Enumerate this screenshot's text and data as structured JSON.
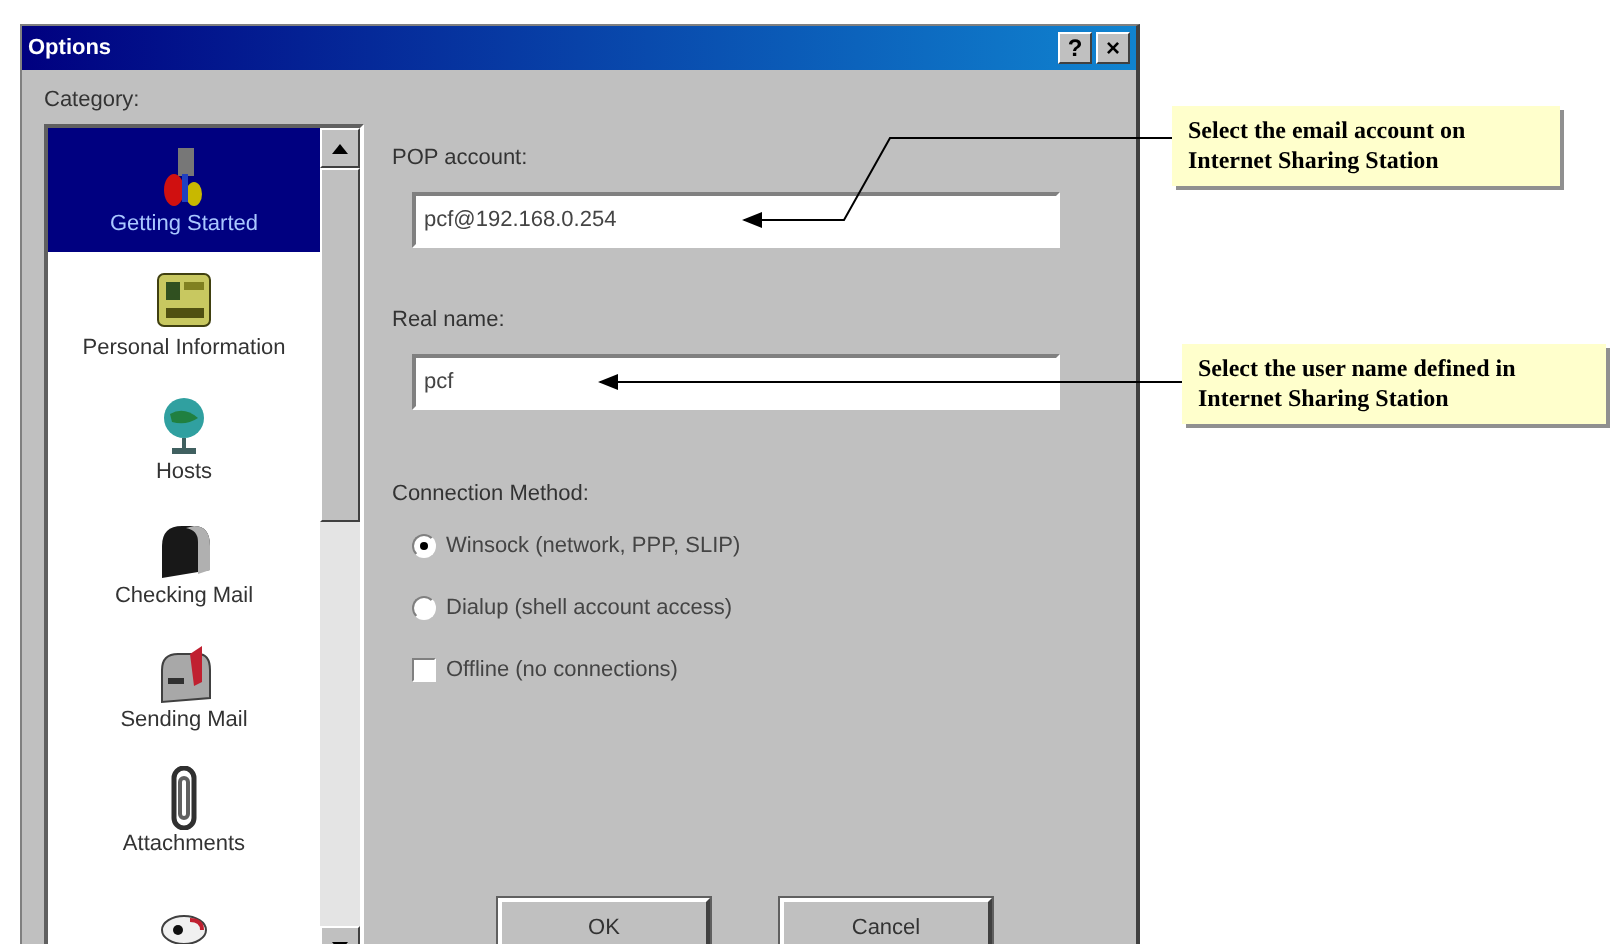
{
  "window": {
    "title": "Options",
    "help_button": "?",
    "close_button": "×"
  },
  "category": {
    "label": "Category:",
    "items": [
      {
        "label": "Getting Started",
        "selected": true
      },
      {
        "label": "Personal Information",
        "selected": false
      },
      {
        "label": "Hosts",
        "selected": false
      },
      {
        "label": "Checking Mail",
        "selected": false
      },
      {
        "label": "Sending Mail",
        "selected": false
      },
      {
        "label": "Attachments",
        "selected": false
      },
      {
        "selected": false
      }
    ]
  },
  "fields": [
    {
      "label": "POP account:",
      "value": "pcf@192.168.0.254"
    },
    {
      "label": "Real name:",
      "value": "pcf"
    }
  ],
  "connection": {
    "label": "Connection Method:",
    "options": [
      {
        "kind": "radio",
        "label": "Winsock (network, PPP, SLIP)",
        "selected": true
      },
      {
        "kind": "radio",
        "label": "Dialup (shell account access)",
        "selected": false
      },
      {
        "kind": "checkbox",
        "label": "Offline (no connections)",
        "checked": false
      }
    ]
  },
  "buttons": [
    "OK",
    "Cancel"
  ],
  "callouts": [
    {
      "text": "Select the email account on Internet Sharing Station"
    },
    {
      "text": "Select the user name defined in Internet Sharing Station"
    }
  ]
}
